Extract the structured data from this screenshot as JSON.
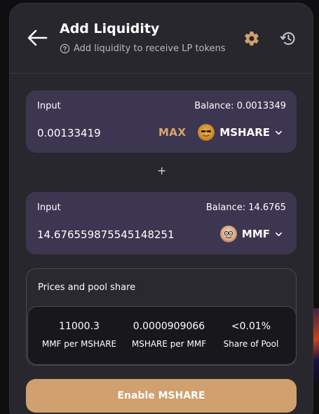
{
  "header": {
    "title": "Add Liquidity",
    "subtitle": "Add liquidity to receive LP tokens"
  },
  "input_a": {
    "label": "Input",
    "balance": "Balance: 0.0013349",
    "amount": "0.00133419",
    "max_label": "MAX",
    "token": "MSHARE"
  },
  "plus_sign": "+",
  "input_b": {
    "label": "Input",
    "balance": "Balance: 14.6765",
    "amount": "14.676559875545148251",
    "token": "MMF"
  },
  "prices": {
    "title": "Prices and pool share",
    "stats": [
      {
        "value": "11000.3",
        "label": "MMF per MSHARE"
      },
      {
        "value": "0.0000909066",
        "label": "MSHARE per MMF"
      },
      {
        "value": "<0.01%",
        "label": "Share of Pool"
      }
    ]
  },
  "enable_button": "Enable MSHARE",
  "colors": {
    "accent": "#d0a06e",
    "card_bg": "#28272d",
    "input_bg": "#3d3650"
  }
}
